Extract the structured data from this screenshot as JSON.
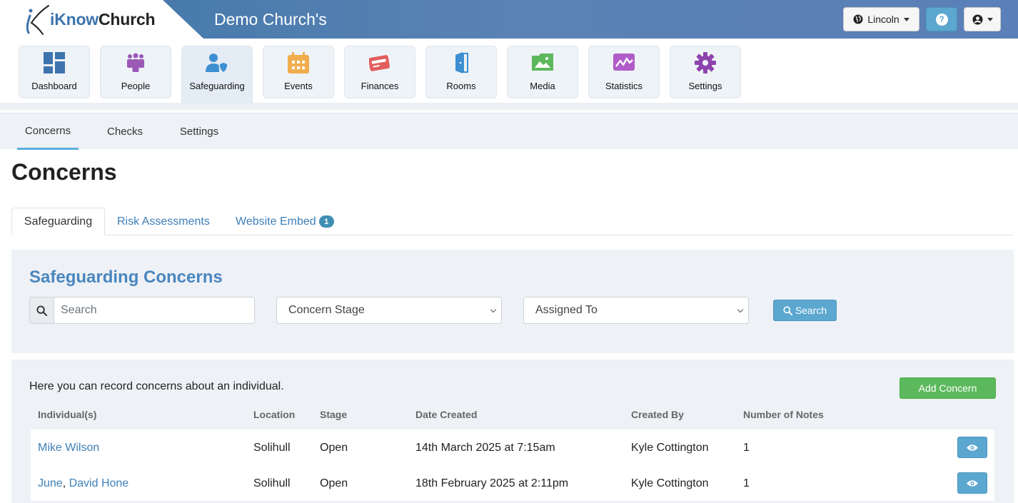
{
  "header": {
    "logo_prefix": "iKnow",
    "logo_suffix": "Church",
    "church_name": "Demo Church's",
    "location_label": "Lincoln",
    "help_label": "?"
  },
  "modules": [
    {
      "label": "Dashboard",
      "icon": "dashboard-icon",
      "color": "#3d74ad"
    },
    {
      "label": "People",
      "icon": "people-icon",
      "color": "#9b59b6"
    },
    {
      "label": "Safeguarding",
      "icon": "safeguarding-icon",
      "color": "#3d8fd1"
    },
    {
      "label": "Events",
      "icon": "calendar-icon",
      "color": "#f0ad4e"
    },
    {
      "label": "Finances",
      "icon": "credit-card-icon",
      "color": "#e25d5d"
    },
    {
      "label": "Rooms",
      "icon": "door-icon",
      "color": "#3d8fd1"
    },
    {
      "label": "Media",
      "icon": "image-icon",
      "color": "#5cb85c"
    },
    {
      "label": "Statistics",
      "icon": "chart-icon",
      "color": "#b15cc9"
    },
    {
      "label": "Settings",
      "icon": "gear-icon",
      "color": "#8e44ad"
    }
  ],
  "subnav": [
    "Concerns",
    "Checks",
    "Settings"
  ],
  "page_title": "Concerns",
  "content_tabs": {
    "safeguarding": "Safeguarding",
    "risk": "Risk Assessments",
    "embed": "Website Embed",
    "embed_badge": "1"
  },
  "filters": {
    "title": "Safeguarding Concerns",
    "search_placeholder": "Search",
    "stage_label": "Concern Stage",
    "assigned_label": "Assigned To",
    "search_button": "Search"
  },
  "table": {
    "intro": "Here you can record concerns about an individual.",
    "add_button": "Add Concern",
    "headers": {
      "individuals": "Individual(s)",
      "location": "Location",
      "stage": "Stage",
      "date": "Date Created",
      "created_by": "Created By",
      "notes": "Number of Notes"
    },
    "rows": [
      {
        "person_a": "Mike Wilson",
        "sep": "",
        "person_b": "",
        "location": "Solihull",
        "stage": "Open",
        "date": "14th March 2025 at 7:15am",
        "created_by": "Kyle Cottington",
        "notes": "1"
      },
      {
        "person_a": "June",
        "sep": ", ",
        "person_b": "David Hone",
        "location": "Solihull",
        "stage": "Open",
        "date": "18th February 2025 at 2:11pm",
        "created_by": "Kyle Cottington",
        "notes": "1"
      }
    ]
  }
}
